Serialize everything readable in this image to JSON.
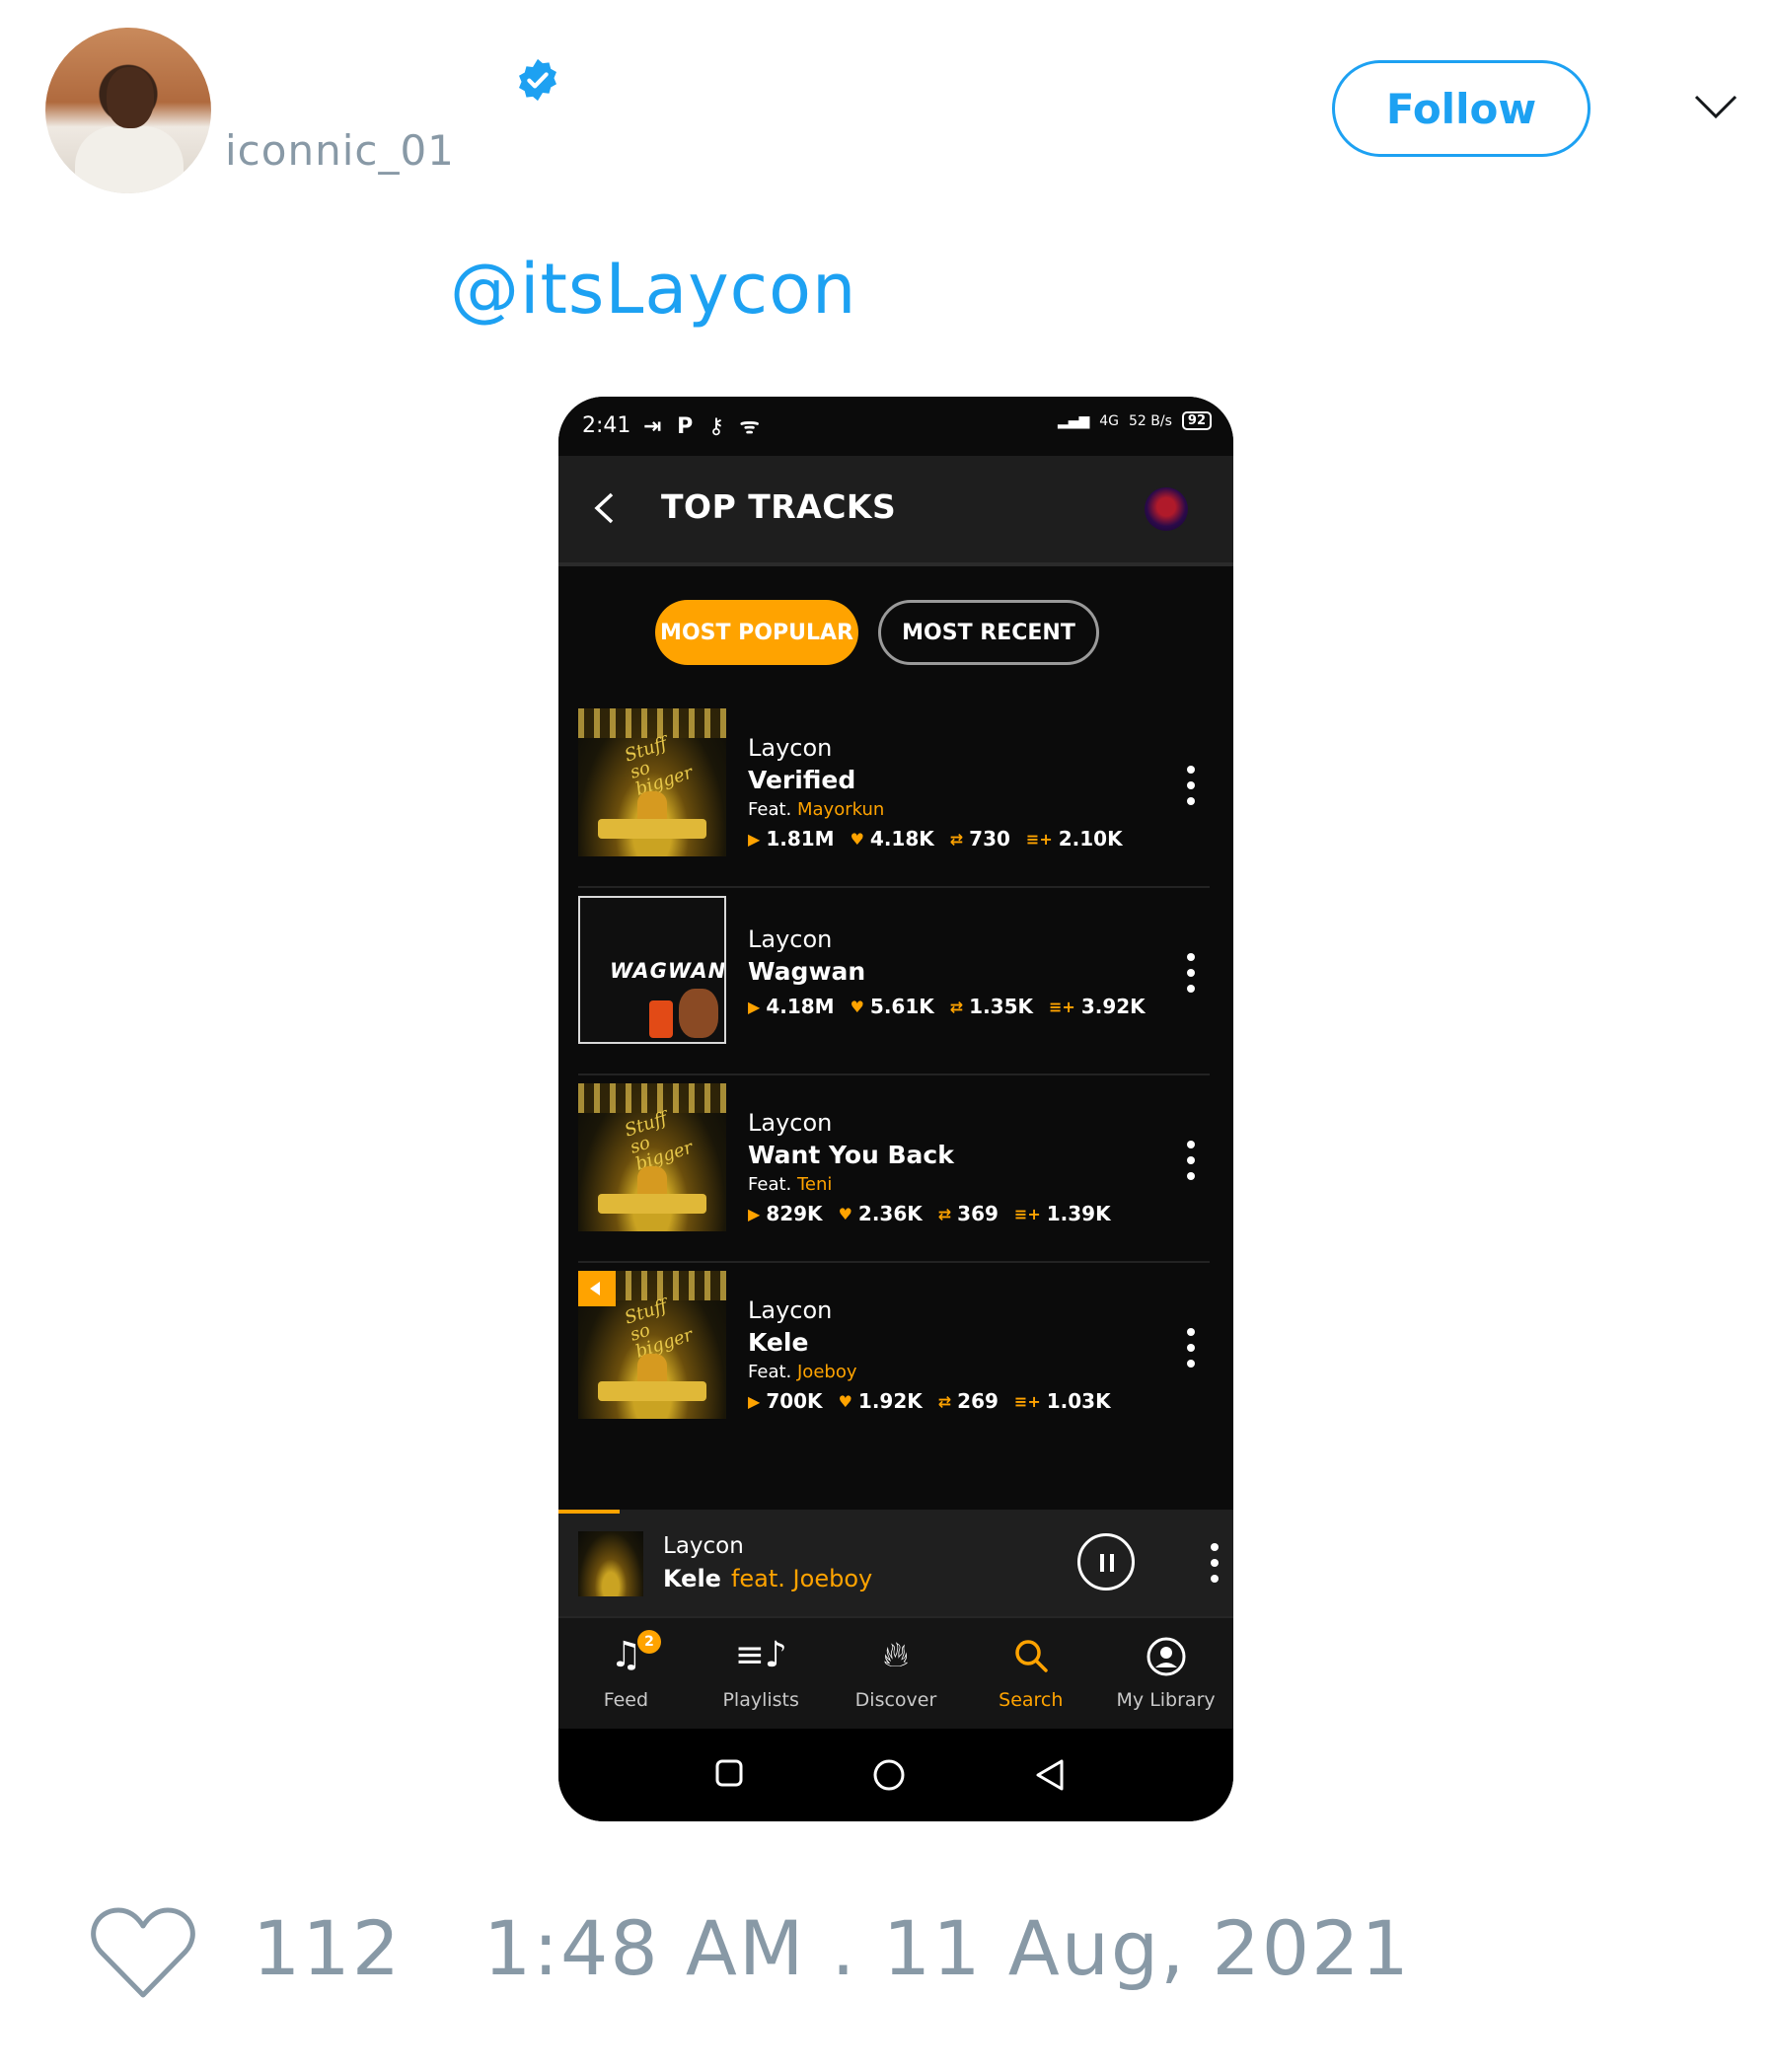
{
  "tweet": {
    "username": "iconnic_01",
    "follow_label": "Follow",
    "mention": "@itsLaycon",
    "likes": "112",
    "timestamp": "1:48 AM . 11 Aug, 2021"
  },
  "phone": {
    "status": {
      "time": "2:41",
      "left_icons": "⇥ P ⚷ ᯤ",
      "network": "4G",
      "speed": "52 B/s",
      "battery": "92"
    },
    "header_title": "TOP TRACKS",
    "tabs": [
      {
        "label": "MOST POPULAR",
        "active": true
      },
      {
        "label": "MOST RECENT",
        "active": false
      }
    ],
    "tracks": [
      {
        "artist": "Laycon",
        "title": "Verified",
        "feat_prefix": "Feat.",
        "feat": "Mayorkun",
        "plays": "1.81M",
        "likes": "4.18K",
        "reposts": "730",
        "adds": "2.10K"
      },
      {
        "artist": "Laycon",
        "title": "Wagwan",
        "cover_text": "WAGWAN",
        "plays": "4.18M",
        "likes": "5.61K",
        "reposts": "1.35K",
        "adds": "3.92K"
      },
      {
        "artist": "Laycon",
        "title": "Want You Back",
        "feat_prefix": "Feat.",
        "feat": "Teni",
        "plays": "829K",
        "likes": "2.36K",
        "reposts": "369",
        "adds": "1.39K"
      },
      {
        "artist": "Laycon",
        "title": "Kele",
        "feat_prefix": "Feat.",
        "feat": "Joeboy",
        "plays": "700K",
        "likes": "1.92K",
        "reposts": "269",
        "adds": "1.03K"
      }
    ],
    "now_playing": {
      "artist": "Laycon",
      "title": "Kele",
      "feat": "feat. Joeboy",
      "progress": 0.09
    },
    "nav": [
      {
        "label": "Feed",
        "icon": "feed-icon",
        "badge": "2"
      },
      {
        "label": "Playlists",
        "icon": "playlists-icon"
      },
      {
        "label": "Discover",
        "icon": "fire-icon"
      },
      {
        "label": "Search",
        "icon": "search-icon",
        "active": true
      },
      {
        "label": "My Library",
        "icon": "account-icon"
      }
    ],
    "colors": {
      "accent": "#ffa300",
      "background": "#0b0b0b",
      "link": "#1da1f2",
      "muted": "#8899a6"
    }
  }
}
